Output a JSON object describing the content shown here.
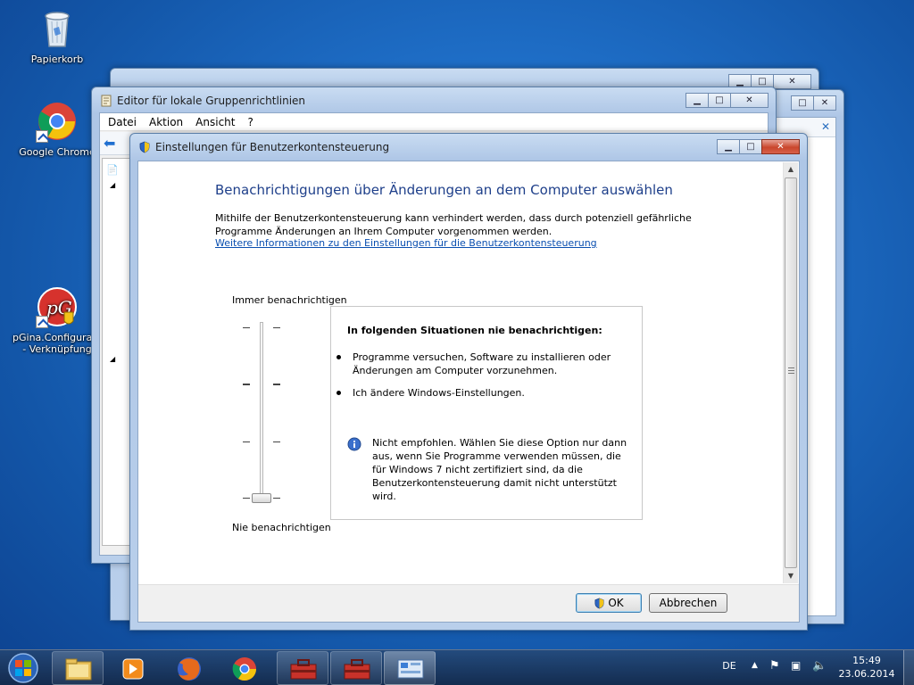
{
  "desktop": {
    "icons": [
      {
        "label": "Papierkorb"
      },
      {
        "label": "Google Chrome"
      },
      {
        "label": "pGina.Configuratio... - Verknüpfung"
      }
    ]
  },
  "gpedit": {
    "title": "Editor für lokale Gruppenrichtlinien",
    "menu": [
      "Datei",
      "Aktion",
      "Ansicht",
      "?"
    ]
  },
  "dialog": {
    "title": "Einstellungen für Benutzerkontensteuerung",
    "heading": "Benachrichtigungen über Änderungen an dem Computer auswählen",
    "description": "Mithilfe der Benutzerkontensteuerung kann verhindert werden, dass durch potenziell gefährliche Programme Änderungen an Ihrem Computer vorgenommen werden.",
    "link": "Weitere Informationen zu den Einstellungen für die Benutzerkontensteuerung",
    "slider": {
      "top_label": "Immer benachrichtigen",
      "bottom_label": "Nie benachrichtigen",
      "levels": 4,
      "selected_level": 1
    },
    "info": {
      "title": "In folgenden Situationen nie benachrichtigen:",
      "bullets": [
        "Programme versuchen, Software zu installieren oder Änderungen am Computer vorzunehmen.",
        "Ich ändere Windows-Einstellungen."
      ],
      "note": "Nicht empfohlen. Wählen Sie diese Option nur dann aus, wenn Sie Programme verwenden müssen, die für Windows 7 nicht zertifiziert sind, da die Benutzerkontensteuerung damit nicht unterstützt wird."
    },
    "ok_label": "OK",
    "cancel_label": "Abbrechen"
  },
  "taskbar": {
    "language": "DE",
    "time": "15:49",
    "date": "23.06.2014"
  },
  "colors": {
    "heading": "#1e3f8a",
    "link": "#0a4fb0",
    "close_button": "#c9462c"
  }
}
